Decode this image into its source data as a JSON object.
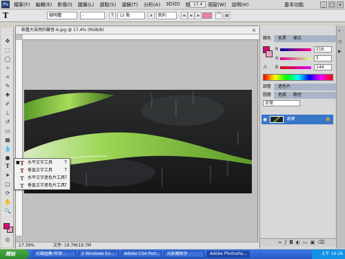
{
  "menubar": {
    "logo": "Ps",
    "items": [
      "檔案(F)",
      "編輯(E)",
      "影像(I)",
      "圖層(L)",
      "選取(S)",
      "濾鏡(T)",
      "分析(A)",
      "3D(D)",
      "檢視(V)",
      "視窗(W)",
      "說明(H)"
    ],
    "zoom": "17.4",
    "workspace": "基本功能",
    "window_controls": [
      "_",
      "□",
      "×"
    ]
  },
  "options_bar": {
    "font_family": "細明體",
    "font_style": "-",
    "font_size": "12 點",
    "antialias": "銳利",
    "text_color": "#f07cb0"
  },
  "document": {
    "tab_title": "影藝大自然的聲音-6.jpg @ 17.4% (RGB/8)",
    "zoom": "17.39%",
    "doc_size": "文件: 19.7M/19.7M"
  },
  "flyout": {
    "items": [
      {
        "bullet": "■",
        "label": "水平文字工具",
        "key": "T"
      },
      {
        "bullet": "",
        "label": "垂直文字工具",
        "key": "T"
      },
      {
        "bullet": "",
        "label": "水平文字遮色片工具",
        "key": "T"
      },
      {
        "bullet": "",
        "label": "垂直文字遮色片工具",
        "key": "T"
      }
    ]
  },
  "color_panel": {
    "tabs": [
      "顏色",
      "色票",
      "樣式"
    ],
    "foreground": "#e0007a",
    "background": "#f0a0c0",
    "channels": [
      {
        "name": "R",
        "value": "216"
      },
      {
        "name": "G",
        "value": "5"
      },
      {
        "name": "B",
        "value": "144"
      }
    ]
  },
  "adjust_panel": {
    "tabs": [
      "調整",
      "遮色片"
    ]
  },
  "layers_panel": {
    "tabs": [
      "圖層",
      "色版",
      "路徑"
    ],
    "blend_mode": "正常",
    "layer_name": "背景"
  },
  "taskbar": {
    "start": "開始",
    "tasks": [
      "光碟圖集-旺得...",
      "2 Windows Ex...",
      "Adobe CS4 Port...",
      "光影魔術手",
      "Adobe Photosho..."
    ],
    "clock": "上午 10:26"
  }
}
